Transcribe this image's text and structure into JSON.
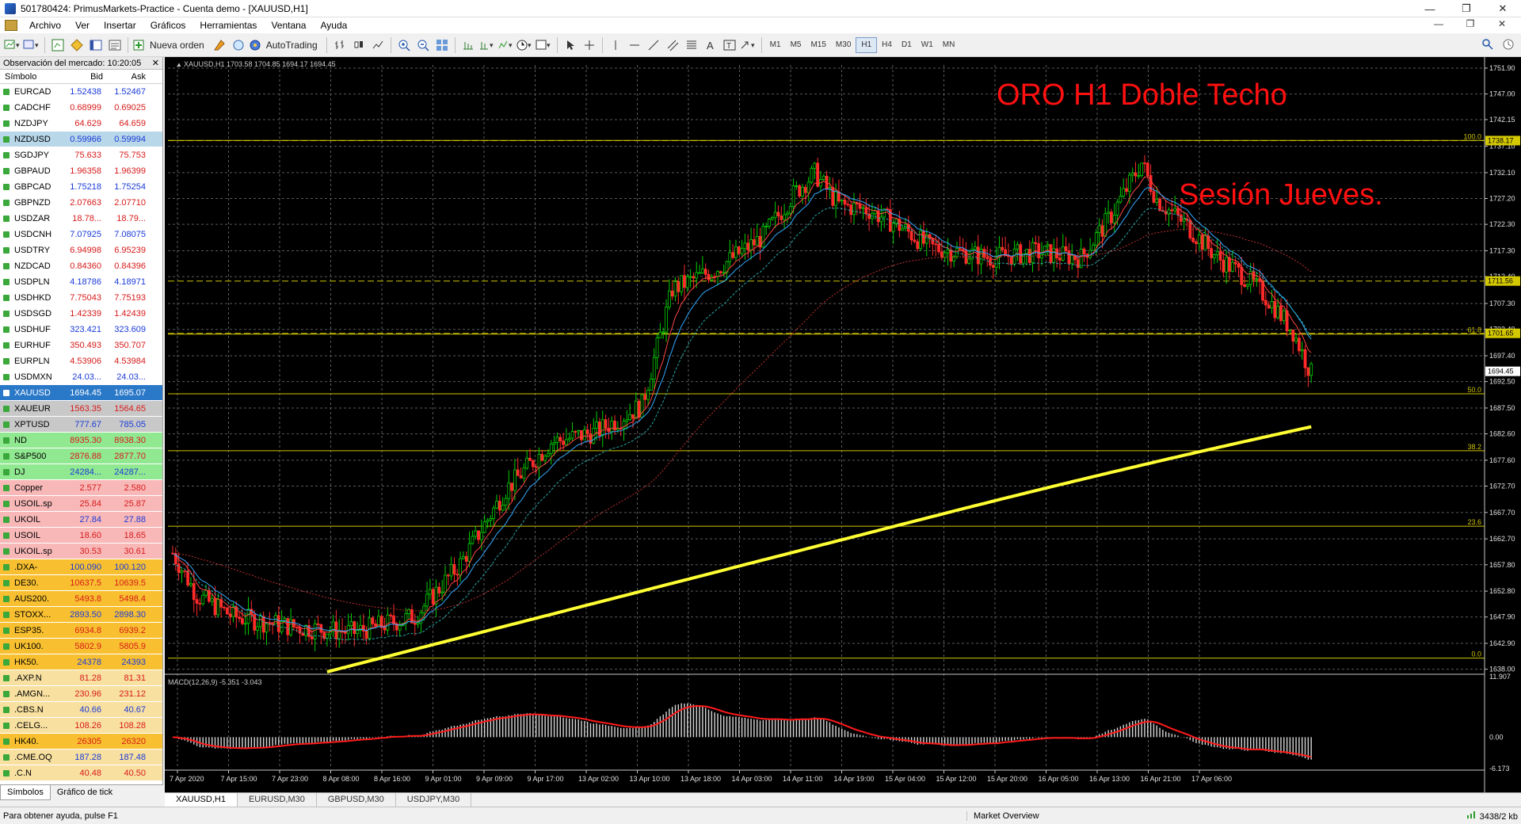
{
  "window": {
    "title": "501780424: PrimusMarkets-Practice - Cuenta demo - [XAUUSD,H1]"
  },
  "menu": [
    "Archivo",
    "Ver",
    "Insertar",
    "Gráficos",
    "Herramientas",
    "Ventana",
    "Ayuda"
  ],
  "toolbar": {
    "new_order": "Nueva orden",
    "autotrading": "AutoTrading",
    "timeframes": [
      "M1",
      "M5",
      "M15",
      "M30",
      "H1",
      "H4",
      "D1",
      "W1",
      "MN"
    ],
    "active_tf": "H1"
  },
  "market_watch": {
    "header": "Observación del mercado: 10:20:05",
    "col_symbol": "Símbolo",
    "col_bid": "Bid",
    "col_ask": "Ask",
    "rows": [
      {
        "s": "EURCAD",
        "b": "1.52438",
        "a": "1.52467",
        "bg": "#ffffff",
        "c": "#000"
      },
      {
        "s": "CADCHF",
        "b": "0.68999",
        "a": "0.69025",
        "bg": "#ffffff",
        "c": "#000"
      },
      {
        "s": "NZDJPY",
        "b": "64.629",
        "a": "64.659",
        "bg": "#ffffff",
        "c": "#000"
      },
      {
        "s": "NZDUSD",
        "b": "0.59966",
        "a": "0.59994",
        "bg": "#b8d8ea",
        "c": "#000"
      },
      {
        "s": "SGDJPY",
        "b": "75.633",
        "a": "75.753",
        "bg": "#ffffff",
        "c": "#000"
      },
      {
        "s": "GBPAUD",
        "b": "1.96358",
        "a": "1.96399",
        "bg": "#ffffff",
        "c": "#000"
      },
      {
        "s": "GBPCAD",
        "b": "1.75218",
        "a": "1.75254",
        "bg": "#ffffff",
        "c": "#000"
      },
      {
        "s": "GBPNZD",
        "b": "2.07663",
        "a": "2.07710",
        "bg": "#ffffff",
        "c": "#000"
      },
      {
        "s": "USDZAR",
        "b": "18.78...",
        "a": "18.79...",
        "bg": "#ffffff",
        "c": "#000"
      },
      {
        "s": "USDCNH",
        "b": "7.07925",
        "a": "7.08075",
        "bg": "#ffffff",
        "c": "#000"
      },
      {
        "s": "USDTRY",
        "b": "6.94998",
        "a": "6.95239",
        "bg": "#ffffff",
        "c": "#000"
      },
      {
        "s": "NZDCAD",
        "b": "0.84360",
        "a": "0.84396",
        "bg": "#ffffff",
        "c": "#000"
      },
      {
        "s": "USDPLN",
        "b": "4.18786",
        "a": "4.18971",
        "bg": "#ffffff",
        "c": "#000"
      },
      {
        "s": "USDHKD",
        "b": "7.75043",
        "a": "7.75193",
        "bg": "#ffffff",
        "c": "#000"
      },
      {
        "s": "USDSGD",
        "b": "1.42339",
        "a": "1.42439",
        "bg": "#ffffff",
        "c": "#000"
      },
      {
        "s": "USDHUF",
        "b": "323.421",
        "a": "323.609",
        "bg": "#ffffff",
        "c": "#000"
      },
      {
        "s": "EURHUF",
        "b": "350.493",
        "a": "350.707",
        "bg": "#ffffff",
        "c": "#000"
      },
      {
        "s": "EURPLN",
        "b": "4.53906",
        "a": "4.53984",
        "bg": "#ffffff",
        "c": "#000"
      },
      {
        "s": "USDMXN",
        "b": "24.03...",
        "a": "24.03...",
        "bg": "#ffffff",
        "c": "#000"
      },
      {
        "s": "XAUUSD",
        "b": "1694.45",
        "a": "1695.07",
        "bg": "#2a78c8",
        "c": "#fff"
      },
      {
        "s": "XAUEUR",
        "b": "1563.35",
        "a": "1564.65",
        "bg": "#c8c8c8",
        "c": "#000"
      },
      {
        "s": "XPTUSD",
        "b": "777.67",
        "a": "785.05",
        "bg": "#c8c8c8",
        "c": "#000"
      },
      {
        "s": "ND",
        "b": "8935.30",
        "a": "8938.30",
        "bg": "#90e890",
        "c": "#000"
      },
      {
        "s": "S&P500",
        "b": "2876.88",
        "a": "2877.70",
        "bg": "#90e890",
        "c": "#000"
      },
      {
        "s": "DJ",
        "b": "24284...",
        "a": "24287...",
        "bg": "#90e890",
        "c": "#000"
      },
      {
        "s": "Copper",
        "b": "2.577",
        "a": "2.580",
        "bg": "#f8b8b8",
        "c": "#000"
      },
      {
        "s": "USOIL.sp",
        "b": "25.84",
        "a": "25.87",
        "bg": "#f8b8b8",
        "c": "#000"
      },
      {
        "s": "UKOIL",
        "b": "27.84",
        "a": "27.88",
        "bg": "#f8b8b8",
        "c": "#000"
      },
      {
        "s": "USOIL",
        "b": "18.60",
        "a": "18.65",
        "bg": "#f8b8b8",
        "c": "#000"
      },
      {
        "s": "UKOIL.sp",
        "b": "30.53",
        "a": "30.61",
        "bg": "#f8b8b8",
        "c": "#000"
      },
      {
        "s": ".DXA-",
        "b": "100.090",
        "a": "100.120",
        "bg": "#f8c030",
        "c": "#000"
      },
      {
        "s": "DE30.",
        "b": "10637.5",
        "a": "10639.5",
        "bg": "#f8c030",
        "c": "#000"
      },
      {
        "s": "AUS200.",
        "b": "5493.8",
        "a": "5498.4",
        "bg": "#f8c030",
        "c": "#000"
      },
      {
        "s": "STOXX...",
        "b": "2893.50",
        "a": "2898.30",
        "bg": "#f8c030",
        "c": "#000"
      },
      {
        "s": "ESP35.",
        "b": "6934.8",
        "a": "6939.2",
        "bg": "#f8c030",
        "c": "#000"
      },
      {
        "s": "UK100.",
        "b": "5802.9",
        "a": "5805.9",
        "bg": "#f8c030",
        "c": "#000"
      },
      {
        "s": "HK50.",
        "b": "24378",
        "a": "24393",
        "bg": "#f8c030",
        "c": "#000"
      },
      {
        "s": ".AXP.N",
        "b": "81.28",
        "a": "81.31",
        "bg": "#f8e0a0",
        "c": "#000"
      },
      {
        "s": ".AMGN...",
        "b": "230.96",
        "a": "231.12",
        "bg": "#f8e0a0",
        "c": "#000"
      },
      {
        "s": ".CBS.N",
        "b": "40.66",
        "a": "40.67",
        "bg": "#f8e0a0",
        "c": "#000"
      },
      {
        "s": ".CELG...",
        "b": "108.26",
        "a": "108.28",
        "bg": "#f8e0a0",
        "c": "#000"
      },
      {
        "s": "HK40.",
        "b": "26305",
        "a": "26320",
        "bg": "#f8c030",
        "c": "#000"
      },
      {
        "s": ".CME.OQ",
        "b": "187.28",
        "a": "187.48",
        "bg": "#f8e0a0",
        "c": "#000"
      },
      {
        "s": ".C.N",
        "b": "40.48",
        "a": "40.50",
        "bg": "#f8e0a0",
        "c": "#000"
      }
    ],
    "tabs": [
      "Símbolos",
      "Gráfico de tick"
    ]
  },
  "chart": {
    "header": "XAUUSD,H1  1703.58 1704.85 1694.17 1694.45",
    "annotation1": "ORO H1  Doble Techo",
    "annotation2": "Sesión Jueves.",
    "macd_label": "MACD(12,26,9) -5.351 -3.043",
    "price_ticks": [
      "1751.90",
      "1747.00",
      "1742.15",
      "1737.10",
      "1732.10",
      "1727.20",
      "1722.30",
      "1717.30",
      "1712.40",
      "1707.30",
      "1702.40",
      "1697.40",
      "1692.50",
      "1687.50",
      "1682.60",
      "1677.60",
      "1672.70",
      "1667.70",
      "1662.70",
      "1657.80",
      "1652.80",
      "1647.90",
      "1642.90",
      "1638.00"
    ],
    "macd_ticks": [
      "11.907",
      "0.00",
      "-6.173"
    ],
    "fib_levels": [
      {
        "label": "100.0",
        "price": 1738.2
      },
      {
        "label": "61.8",
        "price": 1701.5
      },
      {
        "label": "50.0",
        "price": 1690.2
      },
      {
        "label": "38.2",
        "price": 1679.4
      },
      {
        "label": "23.6",
        "price": 1665.1
      },
      {
        "label": "0.0",
        "price": 1640.1
      }
    ],
    "price_tags": [
      {
        "text": "1738.17",
        "price": 1738.17,
        "color": "#d4c800"
      },
      {
        "text": "1711.56",
        "price": 1711.56,
        "color": "#d4c800"
      },
      {
        "text": "1701.65",
        "price": 1701.65,
        "color": "#d4c800"
      },
      {
        "text": "1694.45",
        "price": 1694.45,
        "color": "#ffffff"
      }
    ],
    "time_ticks": [
      "7 Apr 2020",
      "7 Apr 15:00",
      "7 Apr 23:00",
      "8 Apr 08:00",
      "8 Apr 16:00",
      "9 Apr 01:00",
      "9 Apr 09:00",
      "9 Apr 17:00",
      "13 Apr 02:00",
      "13 Apr 10:00",
      "13 Apr 18:00",
      "14 Apr 03:00",
      "14 Apr 11:00",
      "14 Apr 19:00",
      "15 Apr 04:00",
      "15 Apr 12:00",
      "15 Apr 20:00",
      "16 Apr 05:00",
      "16 Apr 13:00",
      "16 Apr 21:00",
      "17 Apr 06:00"
    ]
  },
  "chart_tabs": [
    "XAUUSD,H1",
    "EURUSD,M30",
    "GBPUSD,M30",
    "USDJPY,M30"
  ],
  "status": {
    "help": "Para obtener ayuda, pulse F1",
    "profile": "Market Overview",
    "traffic": "3438/2 kb"
  },
  "colors": {
    "bull": "#00d000",
    "bear": "#ff2a2a",
    "ma_long": "#ffff33",
    "grid": "#5a5a5a",
    "level": "#cfc400"
  }
}
